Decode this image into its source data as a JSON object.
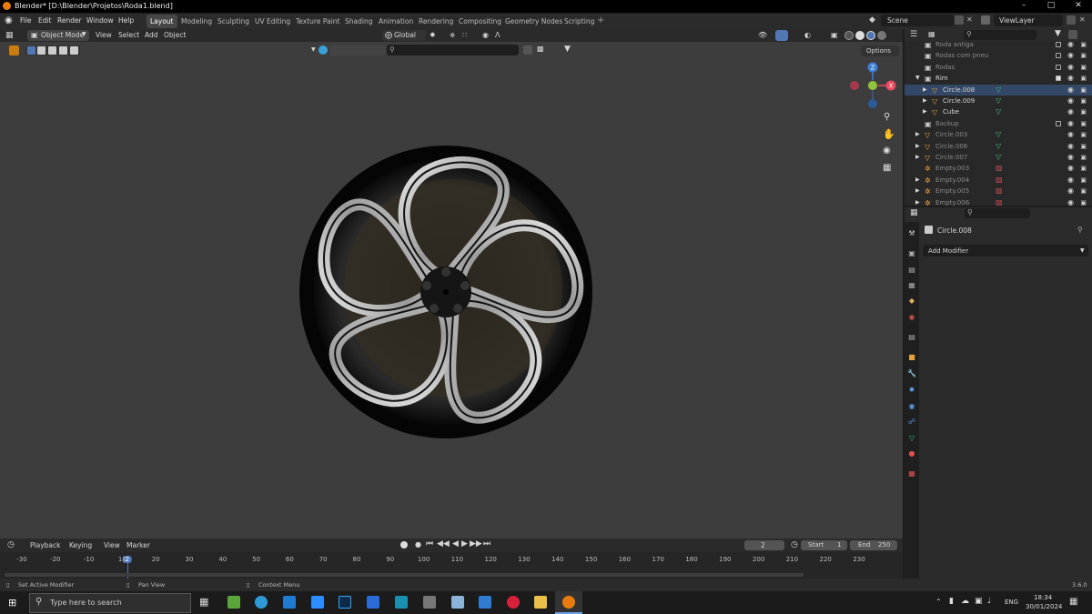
{
  "titlebar": {
    "title": "Blender* [D:\\Blender\\Projetos\\Roda1.blend]"
  },
  "menu": [
    "File",
    "Edit",
    "Render",
    "Window",
    "Help"
  ],
  "workspaces": [
    "Layout",
    "Modeling",
    "Sculpting",
    "UV Editing",
    "Texture Paint",
    "Shading",
    "Animation",
    "Rendering",
    "Compositing",
    "Geometry Nodes",
    "Scripting"
  ],
  "active_workspace": "Layout",
  "scene": {
    "label": "Scene",
    "viewlayer": "ViewLayer"
  },
  "viewport_header": {
    "mode": "Object Mode",
    "menus": [
      "View",
      "Select",
      "Add",
      "Object"
    ],
    "orientation": "Global",
    "options": "Options"
  },
  "gizmo": {
    "z": "Z",
    "y": "Y",
    "x": "X"
  },
  "outliner": {
    "rows": [
      {
        "name": "Roda antiga",
        "dim": true
      },
      {
        "name": "Rodas com pneu",
        "dim": true
      },
      {
        "name": "Rodas",
        "dim": true
      },
      {
        "name": "Rim",
        "dim": false
      },
      {
        "name": "Circle.008",
        "dim": false
      },
      {
        "name": "Circle.009",
        "dim": false
      },
      {
        "name": "Cube",
        "dim": false
      },
      {
        "name": "Backup",
        "dim": true
      },
      {
        "name": "Circle.003",
        "dim": true
      },
      {
        "name": "Circle.006",
        "dim": true
      },
      {
        "name": "Circle.007",
        "dim": true
      },
      {
        "name": "Empty.003",
        "dim": true
      },
      {
        "name": "Empty.004",
        "dim": true
      },
      {
        "name": "Empty.005",
        "dim": true
      },
      {
        "name": "Empty.006",
        "dim": true
      }
    ]
  },
  "properties": {
    "object_name": "Circle.008",
    "add_modifier": "Add Modifier"
  },
  "timeline": {
    "menus": [
      "Playback",
      "Keying",
      "View",
      "Marker"
    ],
    "current_frame": "2",
    "start_label": "Start",
    "start": "1",
    "end_label": "End",
    "end": "250",
    "ticks": [
      "-30",
      "-20",
      "-10",
      "2",
      "10",
      "20",
      "30",
      "40",
      "50",
      "60",
      "70",
      "80",
      "90",
      "100",
      "110",
      "120",
      "130",
      "140",
      "150",
      "160",
      "170",
      "180",
      "190",
      "200",
      "210",
      "220",
      "230"
    ]
  },
  "statusbar": {
    "hint1": "Set Active Modifier",
    "hint2": "Pan View",
    "hint3": "Context Menu",
    "version": "3.6.0"
  },
  "taskbar": {
    "search_placeholder": "Type here to search",
    "lang": "ENG",
    "time": "18:34",
    "date": "30/01/2024"
  }
}
